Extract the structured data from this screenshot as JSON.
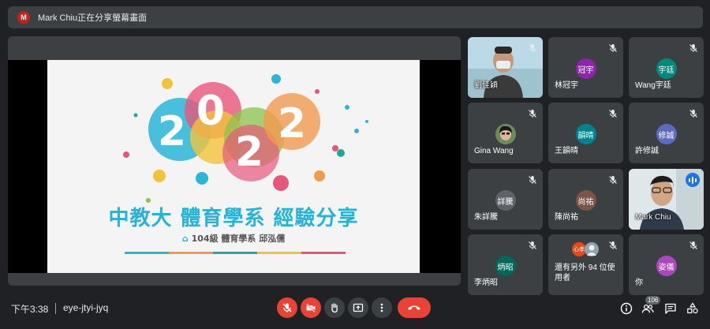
{
  "banner": {
    "avatar_letter": "M",
    "text": "Mark Chiu正在分享螢幕畫面"
  },
  "slide": {
    "digits": [
      "2",
      "0",
      "2",
      "2"
    ],
    "title": "中教大 體育學系 經驗分享",
    "subtitle": "104級 體育學系 邱泓儒"
  },
  "participants": [
    {
      "name": "劉佳穎",
      "avatar_text": "",
      "avatar_color": "",
      "video": true
    },
    {
      "name": "林冠宇",
      "avatar_text": "冠宇",
      "avatar_color": "#8e24aa"
    },
    {
      "name": "Wang宇廷",
      "avatar_text": "宇廷",
      "avatar_color": "#00897b"
    },
    {
      "name": "Gina Wang",
      "avatar_text": "",
      "avatar_color": "#4a4a4a",
      "photo": true
    },
    {
      "name": "王韻晴",
      "avatar_text": "韻晴",
      "avatar_color": "#00838f"
    },
    {
      "name": "許修誠",
      "avatar_text": "修誠",
      "avatar_color": "#5c6bc0"
    },
    {
      "name": "朱詳騰",
      "avatar_text": "詳騰",
      "avatar_color": "#5f6368"
    },
    {
      "name": "陳尚祐",
      "avatar_text": "尚祐",
      "avatar_color": "#795548"
    },
    {
      "name": "Mark Chiu",
      "avatar_text": "",
      "avatar_color": "",
      "video": true,
      "speaking": true
    },
    {
      "name": "李炳昭",
      "avatar_text": "炳昭",
      "avatar_color": "#00695c"
    },
    {
      "name": "還有另外 94 位使用者",
      "avatar_text": "",
      "avatar_color": "",
      "extra": true,
      "mini_avatar_text": "心孝"
    },
    {
      "name": "你",
      "avatar_text": "姿儀",
      "avatar_color": "#ab47bc"
    }
  ],
  "bottom": {
    "time": "下午3:38",
    "meeting_code": "eye-jtyi-jyq",
    "participant_count": "106"
  },
  "colors": {
    "background": "#202124",
    "tile": "#3c4043",
    "danger": "#ea4335",
    "accent": "#8ab4f8",
    "slide_title": "#25b3d6"
  },
  "icons": [
    "mic-off-icon",
    "camera-off-icon",
    "raise-hand-icon",
    "present-icon",
    "more-vert-icon",
    "end-call-icon",
    "info-icon",
    "people-icon",
    "chat-icon",
    "activities-icon"
  ]
}
